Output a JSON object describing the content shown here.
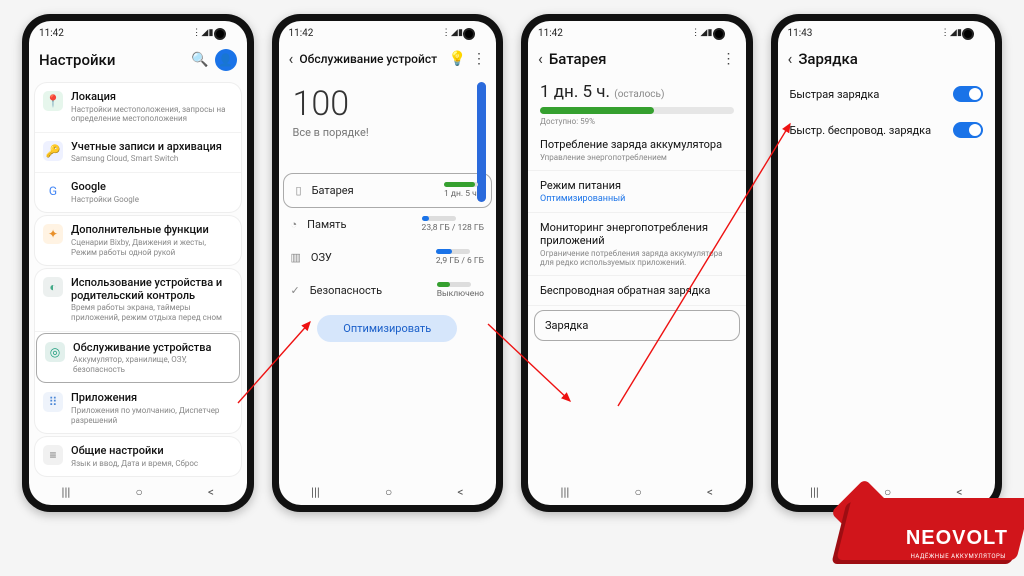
{
  "statusbar": {
    "time1": "11:42",
    "time2": "11:42",
    "time3": "11:42",
    "time4": "11:43",
    "icons": "⋮ ◢ ▮"
  },
  "phone1": {
    "title": "Настройки",
    "avatar_letter": "",
    "groups": [
      {
        "items": [
          {
            "icon": "📍",
            "iconbg": "#e6f6ec",
            "iconc": "#18a558",
            "title": "Локация",
            "sub": "Настройки местоположения, запросы на определение местоположения"
          },
          {
            "icon": "🔑",
            "iconbg": "#eef1ff",
            "iconc": "#4a68d8",
            "title": "Учетные записи и архивация",
            "sub": "Samsung Cloud, Smart Switch"
          },
          {
            "icon": "G",
            "iconbg": "#fff",
            "iconc": "#4285f4",
            "title": "Google",
            "sub": "Настройки Google"
          }
        ]
      },
      {
        "items": [
          {
            "icon": "✦",
            "iconbg": "#fff3e3",
            "iconc": "#e8902a",
            "title": "Дополнительные функции",
            "sub": "Сценарии Bixby, Движения и жесты, Режим работы одной рукой"
          }
        ]
      },
      {
        "items": [
          {
            "icon": "◐",
            "iconbg": "#ecf0ef",
            "iconc": "#4a8",
            "title": "Использование устройства и родительский контроль",
            "sub": "Время работы экрана, таймеры приложений, режим отдыха перед сном"
          },
          {
            "icon": "◎",
            "iconbg": "#e2f0ec",
            "iconc": "#1b9c7c",
            "title": "Обслуживание устройства",
            "sub": "Аккумулятор, хранилище, ОЗУ, безопасность",
            "highlight": true
          },
          {
            "icon": "⠿",
            "iconbg": "#eef3fb",
            "iconc": "#4a87d6",
            "title": "Приложения",
            "sub": "Приложения по умолчанию, Диспетчер разрешений"
          }
        ]
      },
      {
        "items": [
          {
            "icon": "≡",
            "iconbg": "#f1f1f1",
            "iconc": "#777",
            "title": "Общие настройки",
            "sub": "Язык и ввод, Дата и время, Сброс"
          }
        ]
      }
    ]
  },
  "phone2": {
    "title": "Обслуживание устройст",
    "score": "100",
    "score_sub": "Все в порядке!",
    "rows": [
      {
        "icon": "▯",
        "label": "Батарея",
        "val": "1 дн. 5 ч.",
        "bar": 90,
        "color": "#35a02f",
        "highlight": true
      },
      {
        "icon": "◔",
        "label": "Память",
        "val": "23,8 ГБ / 128 ГБ",
        "bar": 22,
        "color": "#1a73e8"
      },
      {
        "icon": "▥",
        "label": "ОЗУ",
        "val": "2,9 ГБ / 6 ГБ",
        "bar": 48,
        "color": "#1a73e8"
      },
      {
        "icon": "✓",
        "label": "Безопасность",
        "val": "Выключено",
        "bar": 40,
        "color": "#35a02f"
      }
    ],
    "optimize": "Оптимизировать"
  },
  "phone3": {
    "title": "Батарея",
    "remaining": "1 дн. 5 ч.",
    "remaining_suffix": "(осталось)",
    "available": "Доступно: 59%",
    "progress_pct": 59,
    "sections": [
      {
        "t": "Потребление заряда аккумулятора",
        "ss": "Управление энергопотреблением"
      },
      {
        "t": "Режим питания",
        "sv": "Оптимизированный"
      },
      {
        "t": "Мониторинг энергопотребления приложений",
        "ss": "Ограничение потребления заряда аккумулятора для редко используемых приложений."
      },
      {
        "t": "Беспроводная обратная зарядка"
      },
      {
        "t": "Зарядка",
        "highlight": true
      }
    ]
  },
  "phone4": {
    "title": "Зарядка",
    "toggles": [
      {
        "label": "Быстрая зарядка"
      },
      {
        "label": "Быстр. беспровод. зарядка"
      }
    ]
  },
  "logo": {
    "brand": "NEOVOLT",
    "tagline": "НАДЁЖНЫЕ АККУМУЛЯТОРЫ"
  },
  "nav": {
    "recent": "|||",
    "home": "○",
    "back": "<"
  }
}
